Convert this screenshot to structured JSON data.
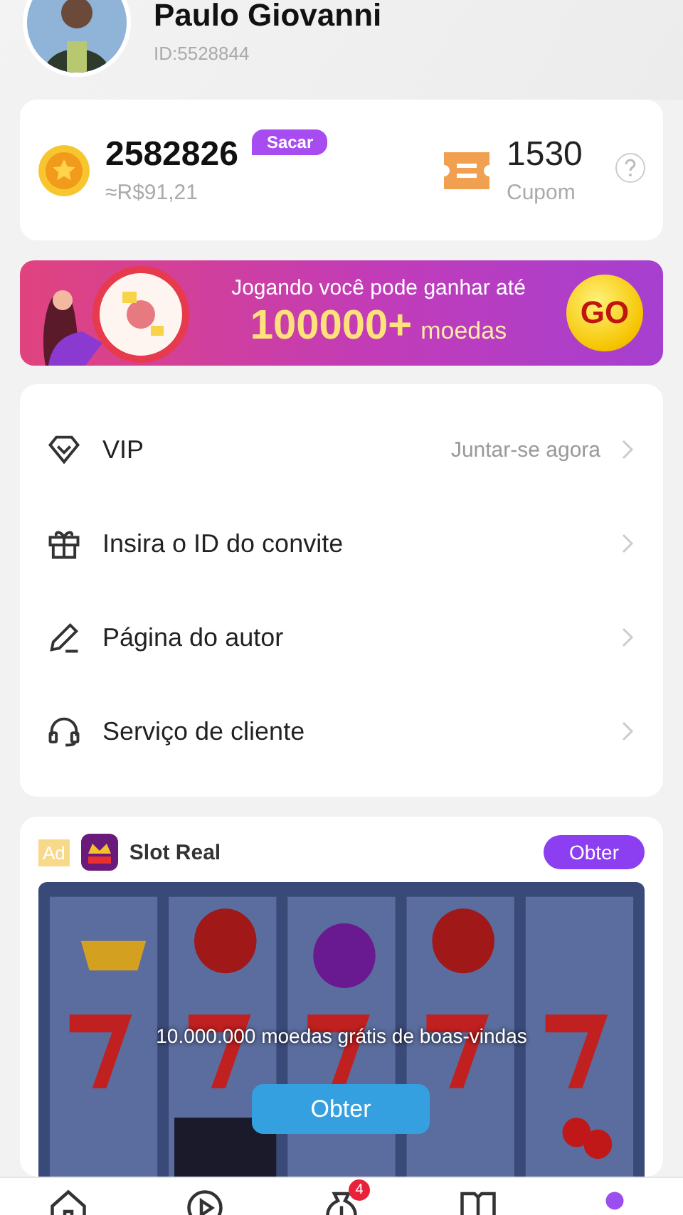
{
  "profile": {
    "name": "Paulo Giovanni",
    "id": "ID:5528844"
  },
  "wallet": {
    "coins": "2582826",
    "withdraw_button": "Sacar",
    "approx_value": "≈R$91,21",
    "coupons": "1530",
    "coupon_label": "Cupom"
  },
  "banner": {
    "line_1": "Jogando você pode ganhar até",
    "amount": "100000+",
    "unit": "moedas",
    "button": "GO"
  },
  "menu": [
    {
      "kind": "vip",
      "label": "VIP",
      "detail": "Juntar-se agora"
    },
    {
      "kind": "gift",
      "label": "Insira o ID do convite"
    },
    {
      "kind": "pen",
      "label": "Página do autor"
    },
    {
      "kind": "headset",
      "label": "Serviço de cliente"
    }
  ],
  "ad": {
    "tag": "Ad",
    "app_name": "Slot Real",
    "get_button": "Obter",
    "caption": "10.000.000 moedas grátis de boas-vindas",
    "cta_button": "Obter"
  },
  "nav": [
    {
      "kind": "home",
      "selected": false
    },
    {
      "kind": "play",
      "selected": false
    },
    {
      "kind": "money",
      "selected": false,
      "badge": "4"
    },
    {
      "kind": "book",
      "selected": false
    },
    {
      "kind": "profile",
      "selected": true
    }
  ]
}
